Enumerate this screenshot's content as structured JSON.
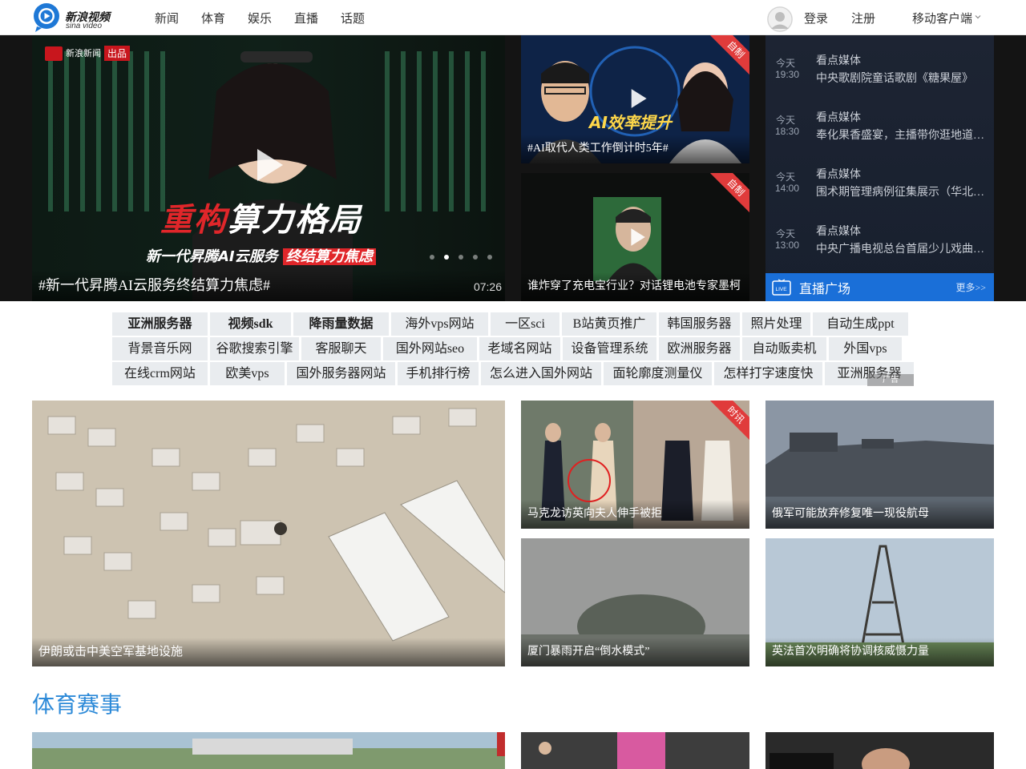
{
  "header": {
    "logo_cn": "新浪视频",
    "logo_en": "sina video",
    "nav": [
      "新闻",
      "体育",
      "娱乐",
      "直播",
      "话题"
    ],
    "login": "登录",
    "register": "注册",
    "mobile": "移动客户端"
  },
  "hero": {
    "title": "#新一代昇腾AI云服务终结算力焦虑#",
    "duration": "07:26",
    "dot_count": 5,
    "active_dot": 2
  },
  "side_videos": [
    {
      "title": "#AI取代人类工作倒计时5年#",
      "ribbon": "自制"
    },
    {
      "title": "谁炸穿了充电宝行业？对话锂电池专家墨柯",
      "ribbon": "自制"
    }
  ],
  "live": {
    "items": [
      {
        "day": "今天",
        "time": "19:30",
        "source": "看点媒体",
        "title": "中央歌剧院童话歌剧《糖果屋》"
      },
      {
        "day": "今天",
        "time": "18:30",
        "source": "看点媒体",
        "title": "奉化果香盛宴，主播带你逛地道“…"
      },
      {
        "day": "今天",
        "time": "14:00",
        "source": "看点媒体",
        "title": "围术期管理病例征集展示（华北…"
      },
      {
        "day": "今天",
        "time": "13:00",
        "source": "看点媒体",
        "title": "中央广播电视总台首届少儿戏曲…"
      }
    ],
    "bar_title": "直播广场",
    "more": "更多>>"
  },
  "keywords": {
    "rows": [
      [
        {
          "text": "亚洲服务器",
          "bold": true
        },
        {
          "text": "视频sdk",
          "bold": true
        },
        {
          "text": "降雨量数据",
          "bold": true
        },
        {
          "text": "海外vps网站",
          "bold": false
        },
        {
          "text": "一区sci",
          "bold": false
        },
        {
          "text": "B站黄页推广",
          "bold": false
        },
        {
          "text": "韩国服务器",
          "bold": false
        },
        {
          "text": "照片处理",
          "bold": false
        },
        {
          "text": "自动生成ppt",
          "bold": false
        }
      ],
      [
        {
          "text": "背景音乐网",
          "bold": false
        },
        {
          "text": "谷歌搜索引擎",
          "bold": false
        },
        {
          "text": "客服聊天",
          "bold": false
        },
        {
          "text": "国外网站seo",
          "bold": false
        },
        {
          "text": "老域名网站",
          "bold": false
        },
        {
          "text": "设备管理系统",
          "bold": false
        },
        {
          "text": "欧洲服务器",
          "bold": false
        },
        {
          "text": "自动贩卖机",
          "bold": false
        },
        {
          "text": "外国vps",
          "bold": false
        }
      ],
      [
        {
          "text": "在线crm网站",
          "bold": false
        },
        {
          "text": "欧美vps",
          "bold": false
        },
        {
          "text": "国外服务器网站",
          "bold": false
        },
        {
          "text": "手机排行榜",
          "bold": false
        },
        {
          "text": "怎么进入国外网站",
          "bold": false
        },
        {
          "text": "面轮廓度测量仪",
          "bold": false
        },
        {
          "text": "怎样打字速度快",
          "bold": false
        },
        {
          "text": "亚洲服务器",
          "bold": false
        }
      ]
    ],
    "ad_label": "广告"
  },
  "news": [
    {
      "title": "伊朗或击中美空军基地设施"
    },
    {
      "title": "马克龙访英向夫人伸手被拒"
    },
    {
      "title": "俄军可能放弃修复唯一现役航母"
    },
    {
      "title": "厦门暴雨开启“倒水模式”"
    },
    {
      "title": "英法首次明确将协调核威慑力量"
    }
  ],
  "section": {
    "title": "体育赛事"
  }
}
